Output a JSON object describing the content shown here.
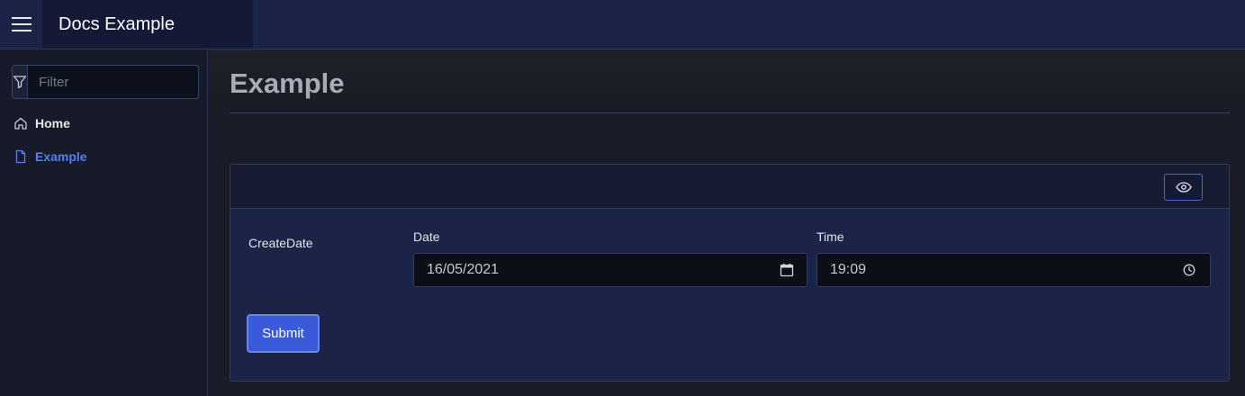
{
  "app": {
    "title": "Docs Example"
  },
  "sidebar": {
    "filter_placeholder": "Filter",
    "items": [
      {
        "label": "Home",
        "icon": "home-icon"
      },
      {
        "label": "Example",
        "icon": "file-icon",
        "active": true
      }
    ]
  },
  "main": {
    "page_title": "Example",
    "form": {
      "field_label": "CreateDate",
      "date_label": "Date",
      "date_value": "16/05/2021",
      "time_label": "Time",
      "time_value": "19:09",
      "submit_label": "Submit"
    }
  },
  "colors": {
    "accent": "#3a5bd9",
    "active_link": "#5b7bf0",
    "topbar": "#1b2447",
    "card": "#1b2447"
  }
}
